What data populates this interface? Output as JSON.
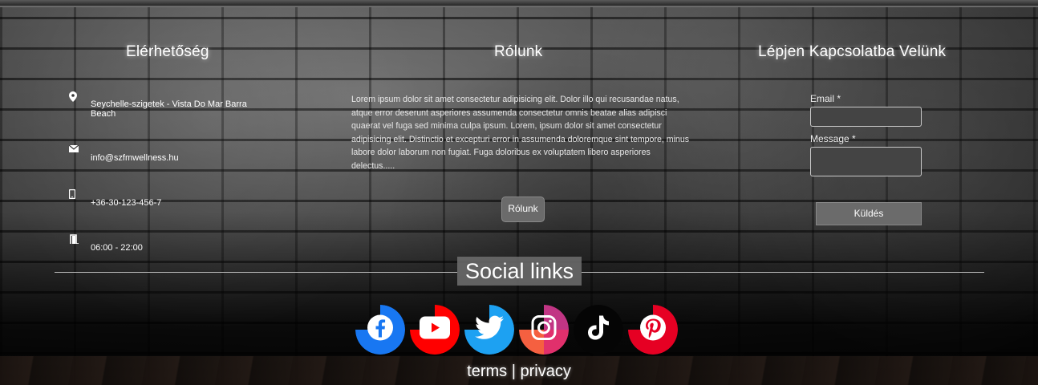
{
  "columns": {
    "contact_title": "Elérhetőség",
    "about_title": "Rólunk",
    "form_title": "Lépjen Kapcsolatba Velünk"
  },
  "contact": {
    "address": "Seychelle-szigetek - Vista Do Mar Barra Beach",
    "email": "info@szfmwellness.hu",
    "phone": "+36-30-123-456-7",
    "hours": "06:00 - 22:00",
    "icons": [
      "map-pin-icon",
      "envelope-icon",
      "mobile-phone-icon",
      "door-icon"
    ]
  },
  "about": {
    "text": "Lorem ipsum dolor sit amet consectetur adipisicing elit. Dolor illo qui recusandae natus, atque error deserunt asperiores assumenda consectetur omnis beatae alias adipisci quaerat vel fuga sed minima culpa ipsum. Lorem, ipsum dolor sit amet consectetur adipisicing elit. Distinctio et excepturi error in assumenda doloremque sint tempore, minus labore dolor laborum non fugiat. Fuga doloribus ex voluptatem libero asperiores delectus.....",
    "button_label": "Rólunk"
  },
  "form": {
    "email_label": "Email *",
    "email_value": "",
    "message_label": "Message *",
    "message_value": "",
    "submit_label": "Küldés"
  },
  "social": {
    "title": "Social links",
    "links": [
      {
        "name": "facebook",
        "icon": "facebook-icon",
        "color": "#1877f2"
      },
      {
        "name": "youtube",
        "icon": "youtube-icon",
        "color": "#ff0000"
      },
      {
        "name": "twitter",
        "icon": "twitter-icon",
        "color": "#1da1f2"
      },
      {
        "name": "instagram",
        "icon": "instagram-icon",
        "color": "#d6249f"
      },
      {
        "name": "tiktok",
        "icon": "tiktok-icon",
        "color": "#000000"
      },
      {
        "name": "pinterest",
        "icon": "pinterest-icon",
        "color": "#e60023"
      }
    ]
  },
  "footer": {
    "terms": "terms",
    "separator": "|",
    "privacy": "privacy"
  }
}
